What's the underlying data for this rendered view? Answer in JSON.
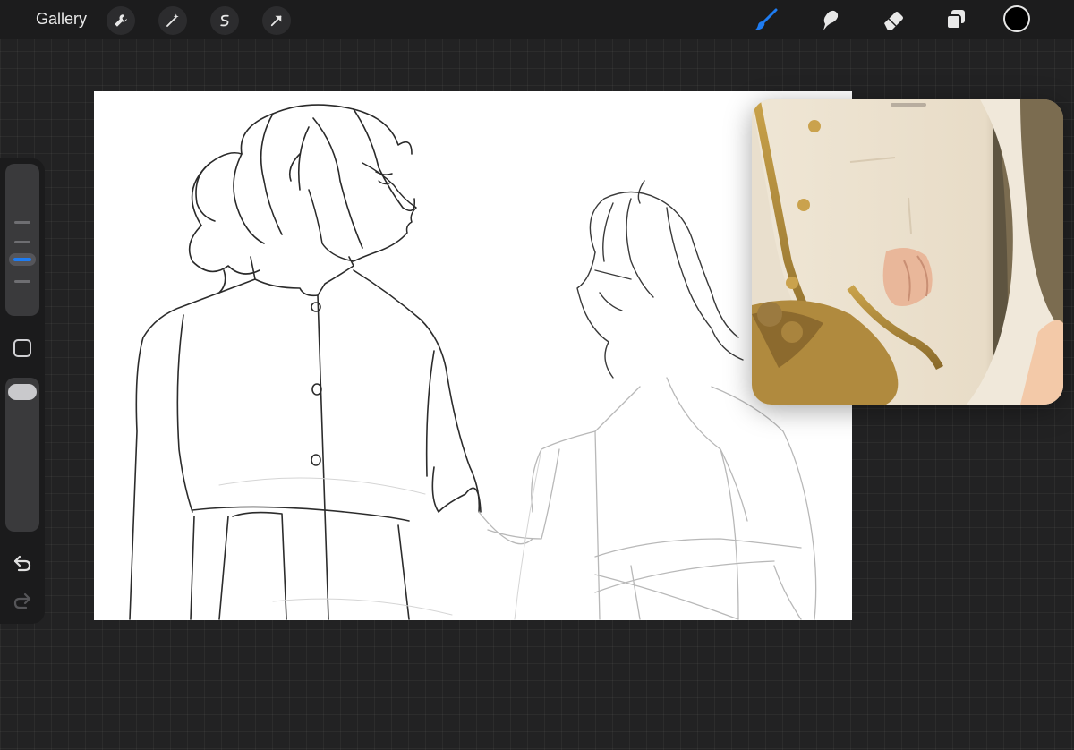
{
  "topbar": {
    "gallery_label": "Gallery",
    "left_tools": [
      "wrench-icon",
      "magic-wand-icon",
      "selection-icon",
      "transform-arrow-icon"
    ],
    "right_tools": [
      "brush-icon",
      "smudge-icon",
      "eraser-icon",
      "layers-icon"
    ],
    "active_tool": "brush-icon",
    "accent_color": "#1e7cf2",
    "current_color": "#000000"
  },
  "sidebar": {
    "brush_size_level": 0.62,
    "opacity_level": 1.0,
    "controls": [
      "brush-size-slider",
      "modify-button",
      "opacity-slider",
      "undo-icon",
      "redo-icon"
    ]
  },
  "canvas": {
    "background": "#ffffff",
    "content": "pencil-sketch"
  },
  "reference_window": {
    "content": "reference-photo"
  }
}
